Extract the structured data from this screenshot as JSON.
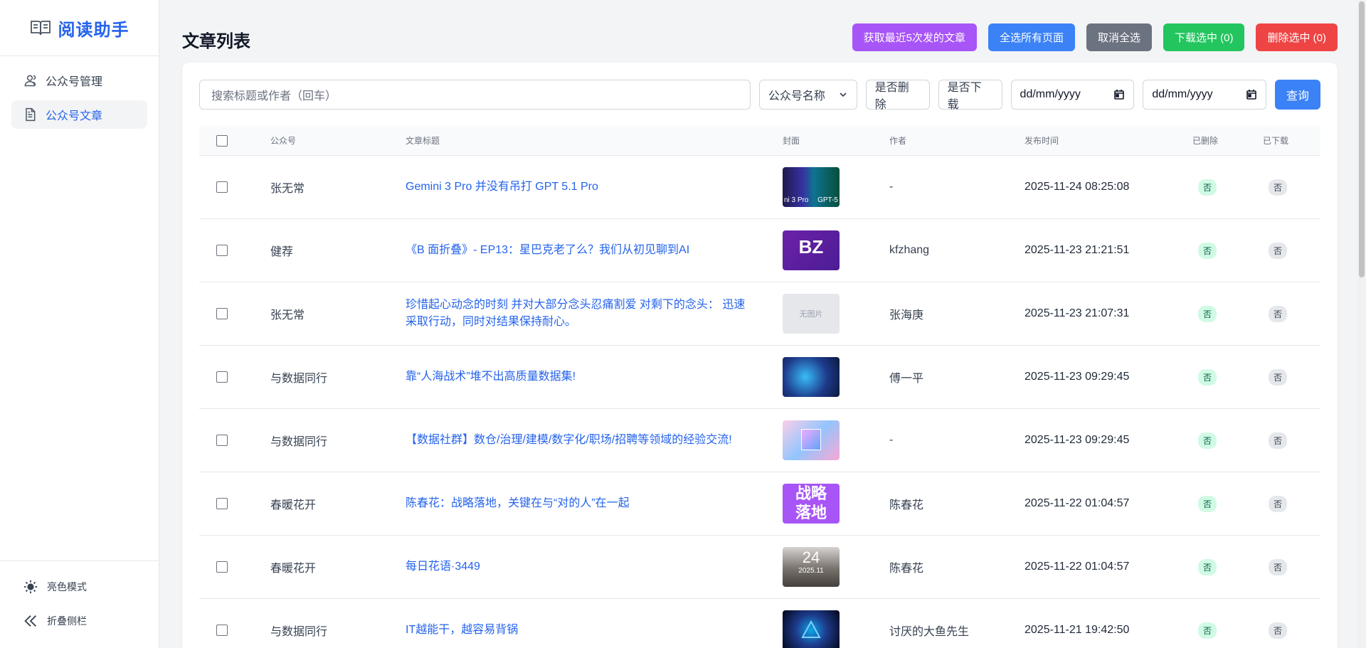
{
  "app": {
    "brand": "阅读助手",
    "page_title": "文章列表"
  },
  "sidebar": {
    "items": [
      {
        "label": "公众号管理",
        "icon": "users-icon"
      },
      {
        "label": "公众号文章",
        "icon": "document-icon"
      }
    ],
    "bottom": [
      {
        "label": "亮色模式",
        "icon": "sun-icon"
      },
      {
        "label": "折叠侧栏",
        "icon": "double-chevron-left-icon"
      }
    ]
  },
  "toolbar": {
    "fetch_label": "获取最近5次发的文章",
    "select_all_label": "全选所有页面",
    "deselect_label": "取消全选",
    "download_label": "下载选中 (0)",
    "delete_label": "删除选中 (0)",
    "colors": {
      "fetch": "#a855f7",
      "select_all": "#3b82f6",
      "deselect": "#6b7280",
      "download": "#22c55e",
      "delete": "#ef4444"
    }
  },
  "filters": {
    "search_placeholder": "搜索标题或作者（回车）",
    "account_select": "公众号名称",
    "deleted_toggle": "是否删除",
    "downloaded_toggle": "是否下载",
    "date_from": "dd/mm/yyyy",
    "date_to": "dd/mm/yyyy",
    "query_label": "查询"
  },
  "table": {
    "columns": [
      "公众号",
      "文章标题",
      "封面",
      "作者",
      "发布时间",
      "已删除",
      "已下载"
    ],
    "rows": [
      {
        "account": "张无常",
        "title": "Gemini 3 Pro 并没有吊打 GPT 5.1 Pro",
        "cover": {
          "type": "image",
          "caption_left": "ni 3 Pro",
          "caption_right": "GPT-5"
        },
        "author": "-",
        "time": "2025-11-24 08:25:08",
        "deleted": "否",
        "downloaded": "否"
      },
      {
        "account": "健荐",
        "title": "《B 面折叠》- EP13：星巴克老了么？我们从初见聊到AI",
        "cover": {
          "type": "image",
          "caption_left": "BZ",
          "caption_right": ""
        },
        "author": "kfzhang",
        "time": "2025-11-23 21:21:51",
        "deleted": "否",
        "downloaded": "否"
      },
      {
        "account": "张无常",
        "title": "珍惜起心动念的时刻 并对大部分念头忍痛割爱 对剩下的念头： 迅速采取行动，同时对结果保持耐心。",
        "cover": {
          "type": "placeholder",
          "text": "无图片"
        },
        "author": "张海庚",
        "time": "2025-11-23 21:07:31",
        "deleted": "否",
        "downloaded": "否"
      },
      {
        "account": "与数据同行",
        "title": "靠“人海战术”堆不出高质量数据集!",
        "cover": {
          "type": "image",
          "caption_left": "",
          "caption_right": ""
        },
        "author": "傅一平",
        "time": "2025-11-23 09:29:45",
        "deleted": "否",
        "downloaded": "否"
      },
      {
        "account": "与数据同行",
        "title": "【数据社群】数仓/治理/建模/数字化/职场/招聘等领域的经验交流!",
        "cover": {
          "type": "image",
          "caption_left": "",
          "caption_right": ""
        },
        "author": "-",
        "time": "2025-11-23 09:29:45",
        "deleted": "否",
        "downloaded": "否"
      },
      {
        "account": "春暖花开",
        "title": "陈春花：战略落地，关键在与“对的人”在一起",
        "cover": {
          "type": "image",
          "caption_left": "战略",
          "caption_right": "落地"
        },
        "author": "陈春花",
        "time": "2025-11-22 01:04:57",
        "deleted": "否",
        "downloaded": "否"
      },
      {
        "account": "春暖花开",
        "title": "每日花语·3449",
        "cover": {
          "type": "image",
          "caption_left": "24",
          "caption_right": "2025.11"
        },
        "author": "陈春花",
        "time": "2025-11-22 01:04:57",
        "deleted": "否",
        "downloaded": "否"
      },
      {
        "account": "与数据同行",
        "title": "IT越能干，越容易背锅",
        "cover": {
          "type": "image",
          "caption_left": "",
          "caption_right": ""
        },
        "author": "讨厌的大鱼先生",
        "time": "2025-11-21 19:42:50",
        "deleted": "否",
        "downloaded": "否"
      }
    ]
  }
}
